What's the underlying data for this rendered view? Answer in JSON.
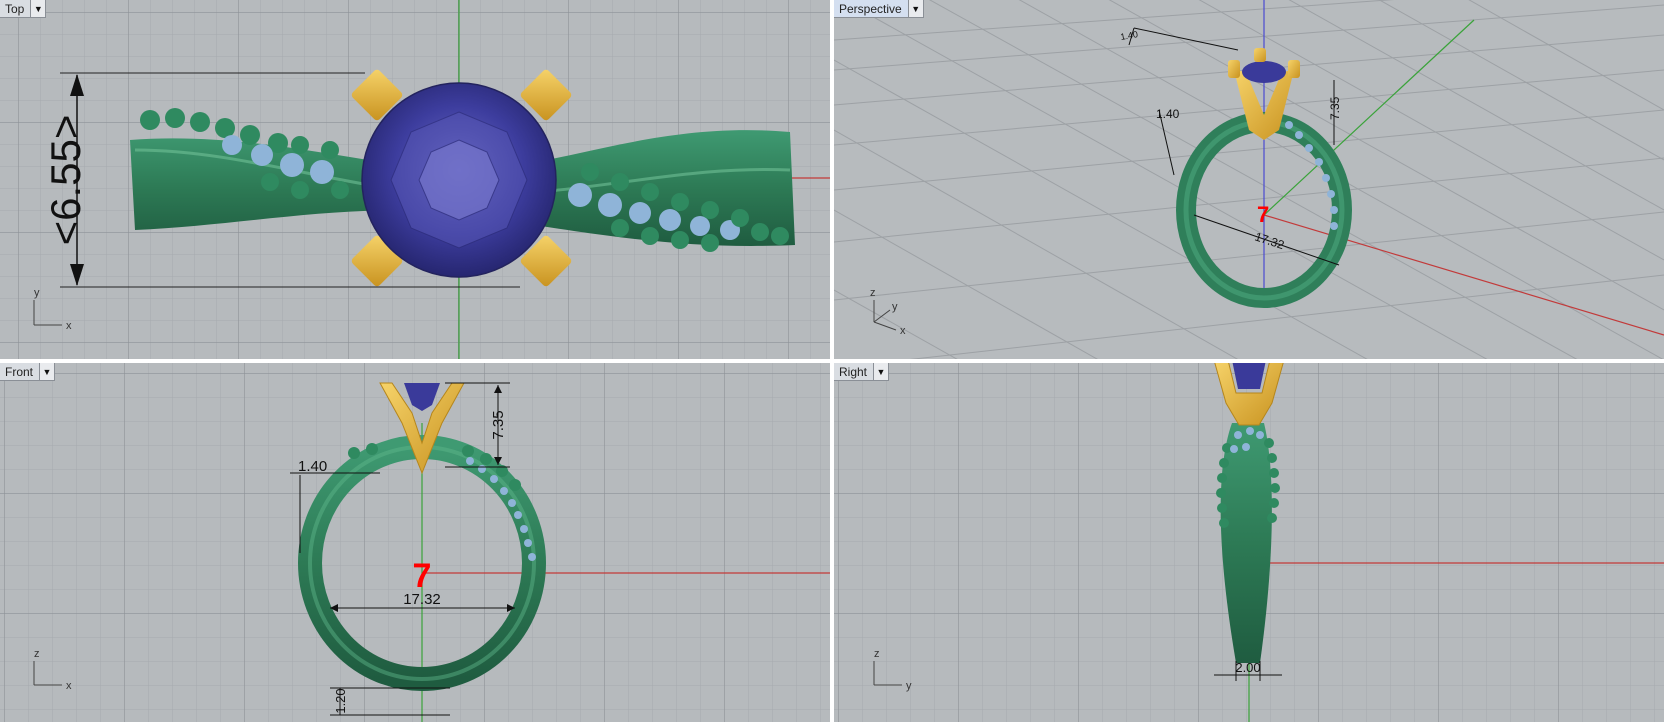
{
  "viewports": {
    "top": {
      "label": "Top",
      "dimension": "<6.55>",
      "axes": {
        "v": "y",
        "h": "x"
      }
    },
    "perspective": {
      "label": "Perspective",
      "dim_width": "1.40",
      "dim_height": "7.35",
      "dim_diameter": "17.32",
      "ring_size": "7",
      "axes": {
        "v": "z",
        "h1": "y",
        "h2": "x"
      }
    },
    "front": {
      "label": "Front",
      "dim_width": "1.40",
      "dim_height": "7.35",
      "dim_diameter": "17.32",
      "dim_bottom": "1.20",
      "ring_size": "7",
      "axes": {
        "v": "z",
        "h": "x"
      }
    },
    "right": {
      "label": "Right",
      "dim_bottom": "2.00",
      "axes": {
        "v": "z",
        "h": "y"
      }
    }
  },
  "menu_arrow_icon": "triangle-down-icon",
  "colors": {
    "viewport_bg": "#b6babd",
    "grid_minor": "#a8acb0",
    "grid_major": "#8f9499",
    "x_axis": "#c23a3a",
    "y_axis": "#3aa33a",
    "z_axis": "#4a4ad0",
    "band_green": "#2f7f5a",
    "prong_gold": "#e2b23a",
    "gem_blue": "#3a3a9a",
    "accent_stones": "#8fb4d8",
    "ring_size_text": "#ff0000"
  }
}
